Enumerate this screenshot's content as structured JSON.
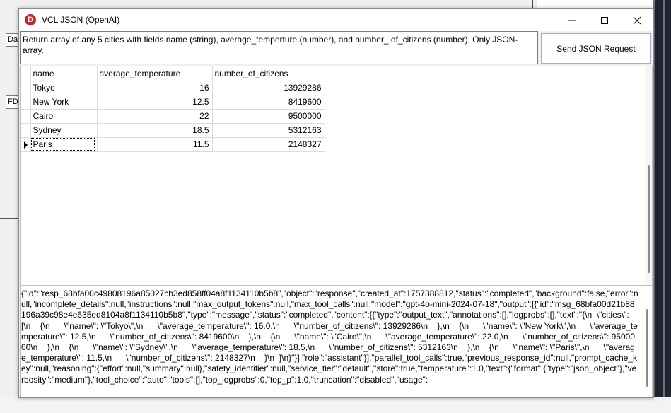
{
  "window": {
    "title": "VCL JSON (OpenAI)",
    "app_icon_letter": "D"
  },
  "background": {
    "btn1_label": "Da",
    "btn2_label": "FD"
  },
  "prompt": {
    "text": "Return array of any 5 cities with fields name (string), average_temperture (number), and number_ of_citizens (number). Only JSON-array."
  },
  "send_button": {
    "label": "Send JSON Request"
  },
  "grid": {
    "columns": [
      "name",
      "average_temperature",
      "number_of_citizens"
    ],
    "rows": [
      {
        "name": "Tokyo",
        "average_temperature": "16",
        "number_of_citizens": "13929286"
      },
      {
        "name": "New York",
        "average_temperature": "12.5",
        "number_of_citizens": "8419600"
      },
      {
        "name": "Cairo",
        "average_temperature": "22",
        "number_of_citizens": "9500000"
      },
      {
        "name": "Sydney",
        "average_temperature": "18.5",
        "number_of_citizens": "5312163"
      },
      {
        "name": "Paris",
        "average_temperature": "11.5",
        "number_of_citizens": "2148327"
      }
    ],
    "selected_row": 4
  },
  "response": {
    "text": "{\"id\":\"resp_68bfa00c49808196a85027cb3ed858ff04a8f1134110b5b8\",\"object\":\"response\",\"created_at\":1757388812,\"status\":\"completed\",\"background\":false,\"error\":null,\"incomplete_details\":null,\"instructions\":null,\"max_output_tokens\":null,\"max_tool_calls\":null,\"model\":\"gpt-4o-mini-2024-07-18\",\"output\":[{\"id\":\"msg_68bfa00d21b88196a39c98e4e635ed8104a8f1134110b5b8\",\"type\":\"message\",\"status\":\"completed\",\"content\":[{\"type\":\"output_text\",\"annotations\":[],\"logprobs\":[],\"text\":\"{\\n  \\\"cities\\\": [\\n    {\\n      \\\"name\\\": \\\"Tokyo\\\",\\n      \\\"average_temperature\\\": 16.0,\\n      \\\"number_of_citizens\\\": 13929286\\n    },\\n    {\\n      \\\"name\\\": \\\"New York\\\",\\n      \\\"average_temperature\\\": 12.5,\\n      \\\"number_of_citizens\\\": 8419600\\n    },\\n    {\\n      \\\"name\\\": \\\"Cairo\\\",\\n      \\\"average_temperature\\\": 22.0,\\n      \\\"number_of_citizens\\\": 9500000\\n    },\\n    {\\n      \\\"name\\\": \\\"Sydney\\\",\\n      \\\"average_temperature\\\": 18.5,\\n      \\\"number_of_citizens\\\": 5312163\\n    },\\n    {\\n      \\\"name\\\": \\\"Paris\\\",\\n      \\\"average_temperature\\\": 11.5,\\n      \\\"number_of_citizens\\\": 2148327\\n    }\\n  ]\\n}\"}],\"role\":\"assistant\"}],\"parallel_tool_calls\":true,\"previous_response_id\":null,\"prompt_cache_key\":null,\"reasoning\":{\"effort\":null,\"summary\":null},\"safety_identifier\":null,\"service_tier\":\"default\",\"store\":true,\"temperature\":1.0,\"text\":{\"format\":{\"type\":\"json_object\"},\"verbosity\":\"medium\"},\"tool_choice\":\"auto\",\"tools\":[],\"top_logprobs\":0,\"top_p\":1.0,\"truncation\":\"disabled\",\"usage\":"
  },
  "colors": {
    "window_bg": "#f0f0f0",
    "icon_red": "#c8262b",
    "desktop_dark": "#1f2430"
  }
}
